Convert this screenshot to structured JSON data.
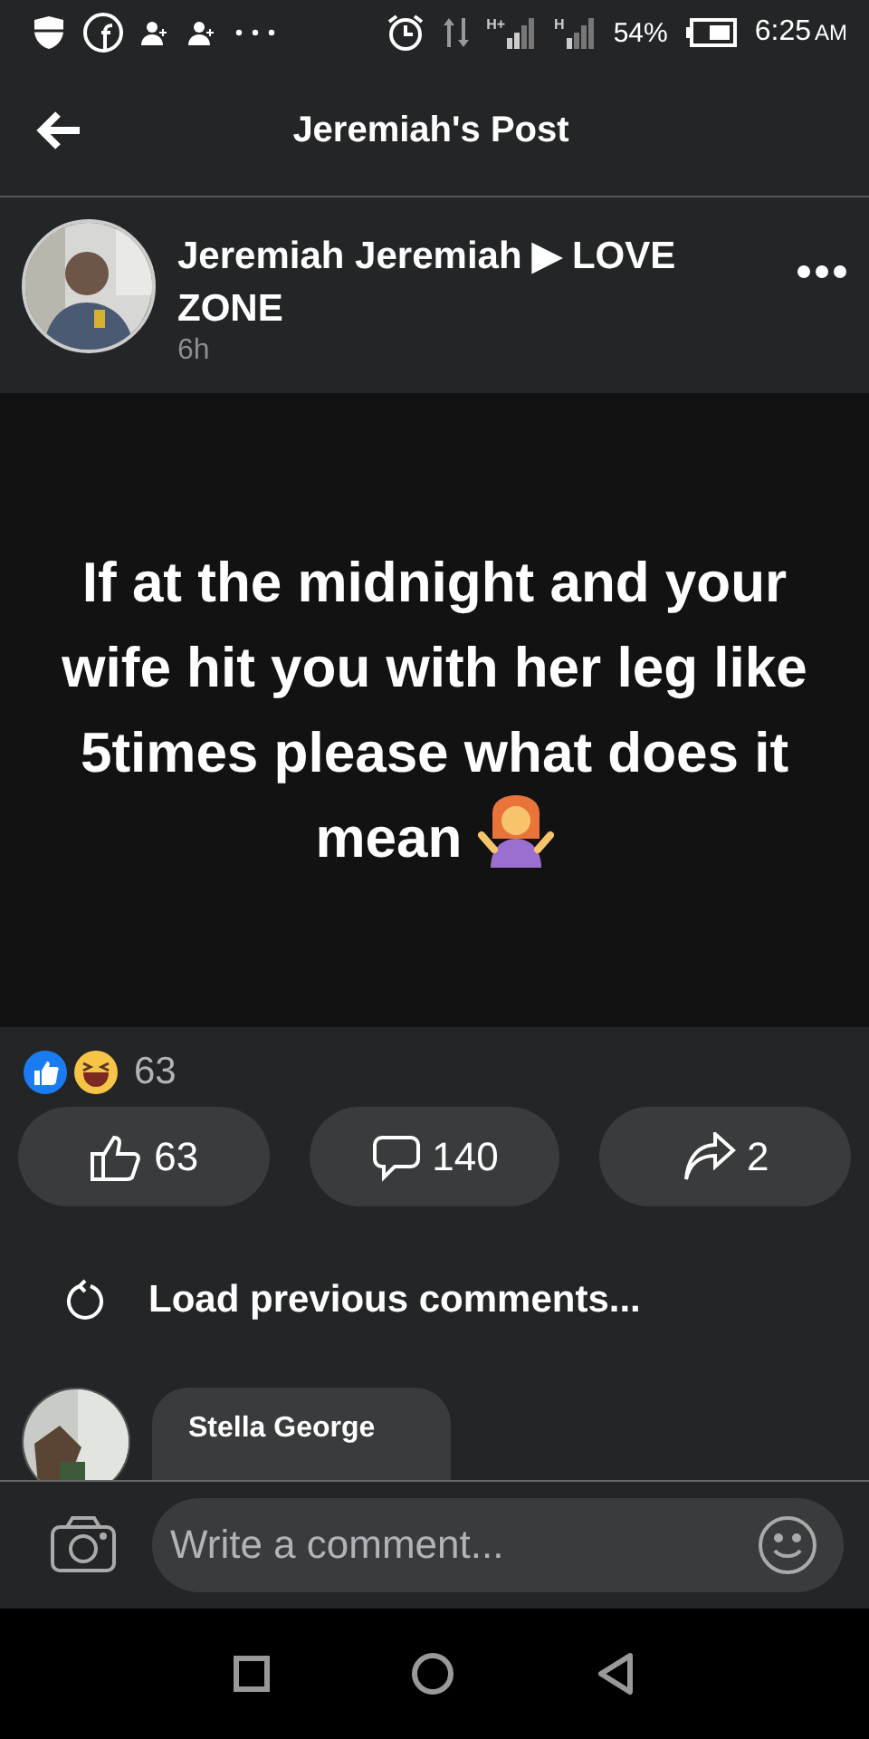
{
  "status_bar": {
    "network_1": "H+",
    "network_2": "H",
    "battery": "54%",
    "time": "6:25",
    "meridiem": "AM"
  },
  "app_bar": {
    "title": "Jeremiah's Post"
  },
  "post": {
    "author": "Jeremiah Jeremiah",
    "separator": "▶",
    "group": "LOVE ZONE",
    "time": "6h",
    "text": "If at the midnight and your wife hit you with her leg like 5times please what does it mean"
  },
  "reactions": {
    "count": "63"
  },
  "actions": [
    {
      "kind": "like",
      "count": "63"
    },
    {
      "kind": "comment",
      "count": "140"
    },
    {
      "kind": "share",
      "count": "2"
    }
  ],
  "load_previous": "Load previous comments...",
  "comments": [
    {
      "author": "Stella George"
    }
  ],
  "composer": {
    "placeholder": "Write a comment..."
  }
}
